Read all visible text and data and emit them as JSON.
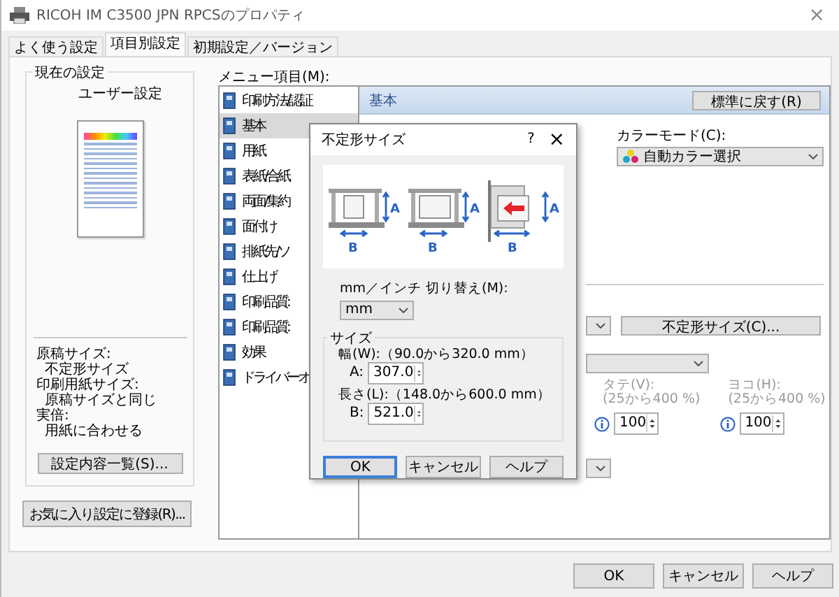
{
  "window": {
    "title": "RICOH IM C3500 JPN RPCSのプロパティ",
    "close": "×"
  },
  "tabs": [
    {
      "label": "よく使う設定",
      "selected": false
    },
    {
      "label": "項目別設定",
      "selected": true
    },
    {
      "label": "初期設定／バージョン",
      "selected": false
    }
  ],
  "current_settings": {
    "title": "現在の設定",
    "profile": "ユーザー設定",
    "summary": [
      {
        "label": "原稿サイズ:",
        "value": "不定形サイズ"
      },
      {
        "label": "印刷用紙サイズ:",
        "value": "原稿サイズと同じ"
      },
      {
        "label": "実倍:",
        "value": "用紙に合わせる"
      }
    ],
    "list_button": "設定内容一覧(S)..."
  },
  "favorite_button": "お気に入り設定に登録(R)...",
  "menu": {
    "label": "メニュー項目(M):",
    "items": [
      {
        "label": "印刷方法/認証",
        "selected": false
      },
      {
        "label": "基本",
        "selected": true
      },
      {
        "label": "用紙",
        "selected": false
      },
      {
        "label": "表紙/合紙",
        "selected": false
      },
      {
        "label": "両面/集約",
        "selected": false
      },
      {
        "label": "面付け",
        "selected": false
      },
      {
        "label": "排紙先/ソ",
        "selected": false
      },
      {
        "label": "仕上げ",
        "selected": false
      },
      {
        "label": "印刷品質:",
        "selected": false
      },
      {
        "label": "印刷品質:",
        "selected": false
      },
      {
        "label": "効果",
        "selected": false
      },
      {
        "label": "ドライバーオ",
        "selected": false
      }
    ]
  },
  "panel": {
    "title": "基本",
    "reset_button": "標準に戻す(R)",
    "color_mode": {
      "label": "カラーモード(C):",
      "value": "自動カラー選択"
    },
    "custom_size_button": "不定形サイズ(C)...",
    "scale": [
      {
        "label": "タテ(V):",
        "range": "(25から400 %)",
        "value": "100",
        "disabled": true
      },
      {
        "label": "ヨコ(H):",
        "range": "(25から400 %)",
        "value": "100",
        "disabled": true
      }
    ]
  },
  "dialog": {
    "title": "不定形サイズ",
    "help": "?",
    "close": "×",
    "diagrams": [
      {
        "a": "A",
        "b": "B"
      },
      {
        "a": "A",
        "b": "B"
      },
      {
        "a": "A",
        "b": "B"
      }
    ],
    "unit_label": "mm／インチ 切り替え(M):",
    "unit_value": "mm",
    "size_group": "サイズ",
    "fields": [
      {
        "range": "幅(W):（90.0から320.0 mm）",
        "label": "A:",
        "value": "307.0"
      },
      {
        "range": "長さ(L):（148.0から600.0 mm）",
        "label": "B:",
        "value": "521.0"
      }
    ],
    "buttons": [
      {
        "label": "OK",
        "selected": true
      },
      {
        "label": "キャンセル",
        "selected": false
      },
      {
        "label": "ヘルプ",
        "selected": false
      }
    ]
  },
  "buttons": [
    "OK",
    "キャンセル",
    "ヘルプ"
  ]
}
